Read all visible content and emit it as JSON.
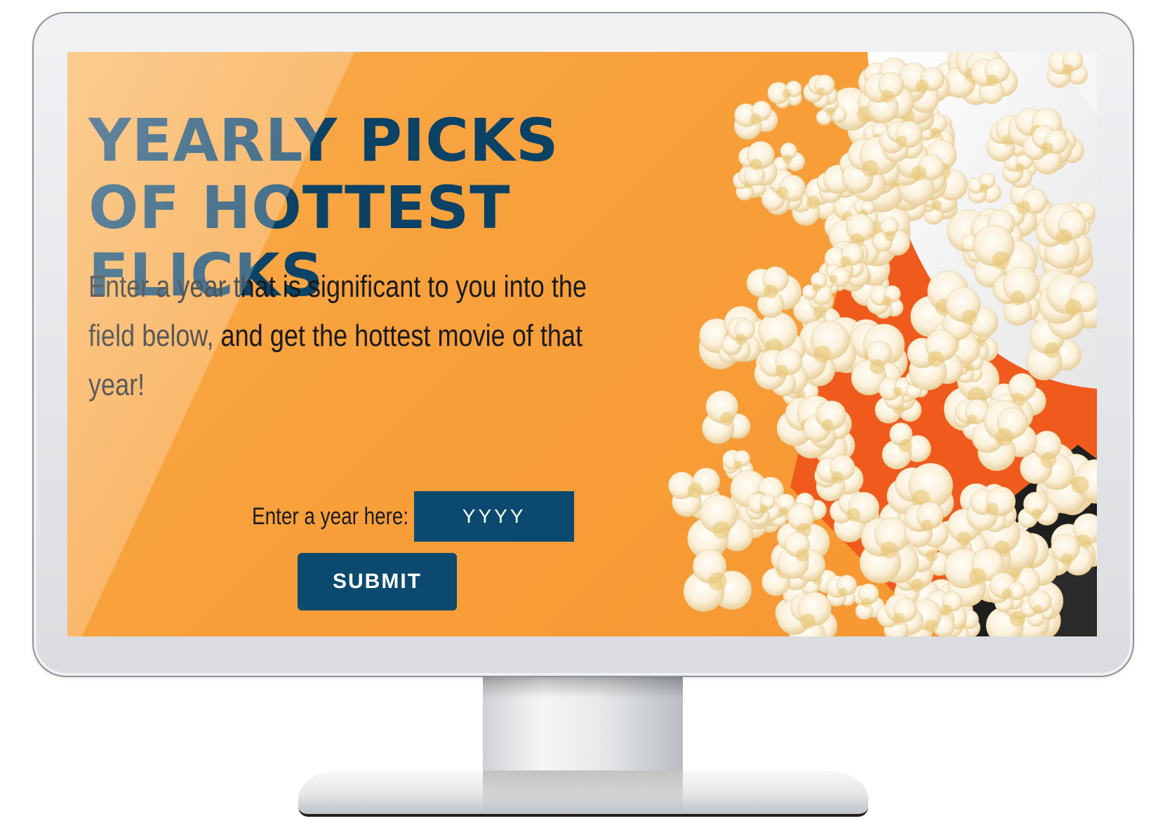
{
  "hero": {
    "headline": "YEARLY PICKS OF HOTTEST FLICKS",
    "intro": "Enter a year that is significant to you into the field below, and get the hottest movie of that year!"
  },
  "form": {
    "year_label": "Enter a year here:",
    "year_value": "",
    "year_placeholder": "YYYY",
    "submit_label": "SUBMIT"
  },
  "theme": {
    "background": "#f8a03b",
    "accent": "#0b4a6e",
    "headline_color": "#0b4266"
  },
  "images": {
    "background_art": "popcorn-bowl-spill"
  }
}
